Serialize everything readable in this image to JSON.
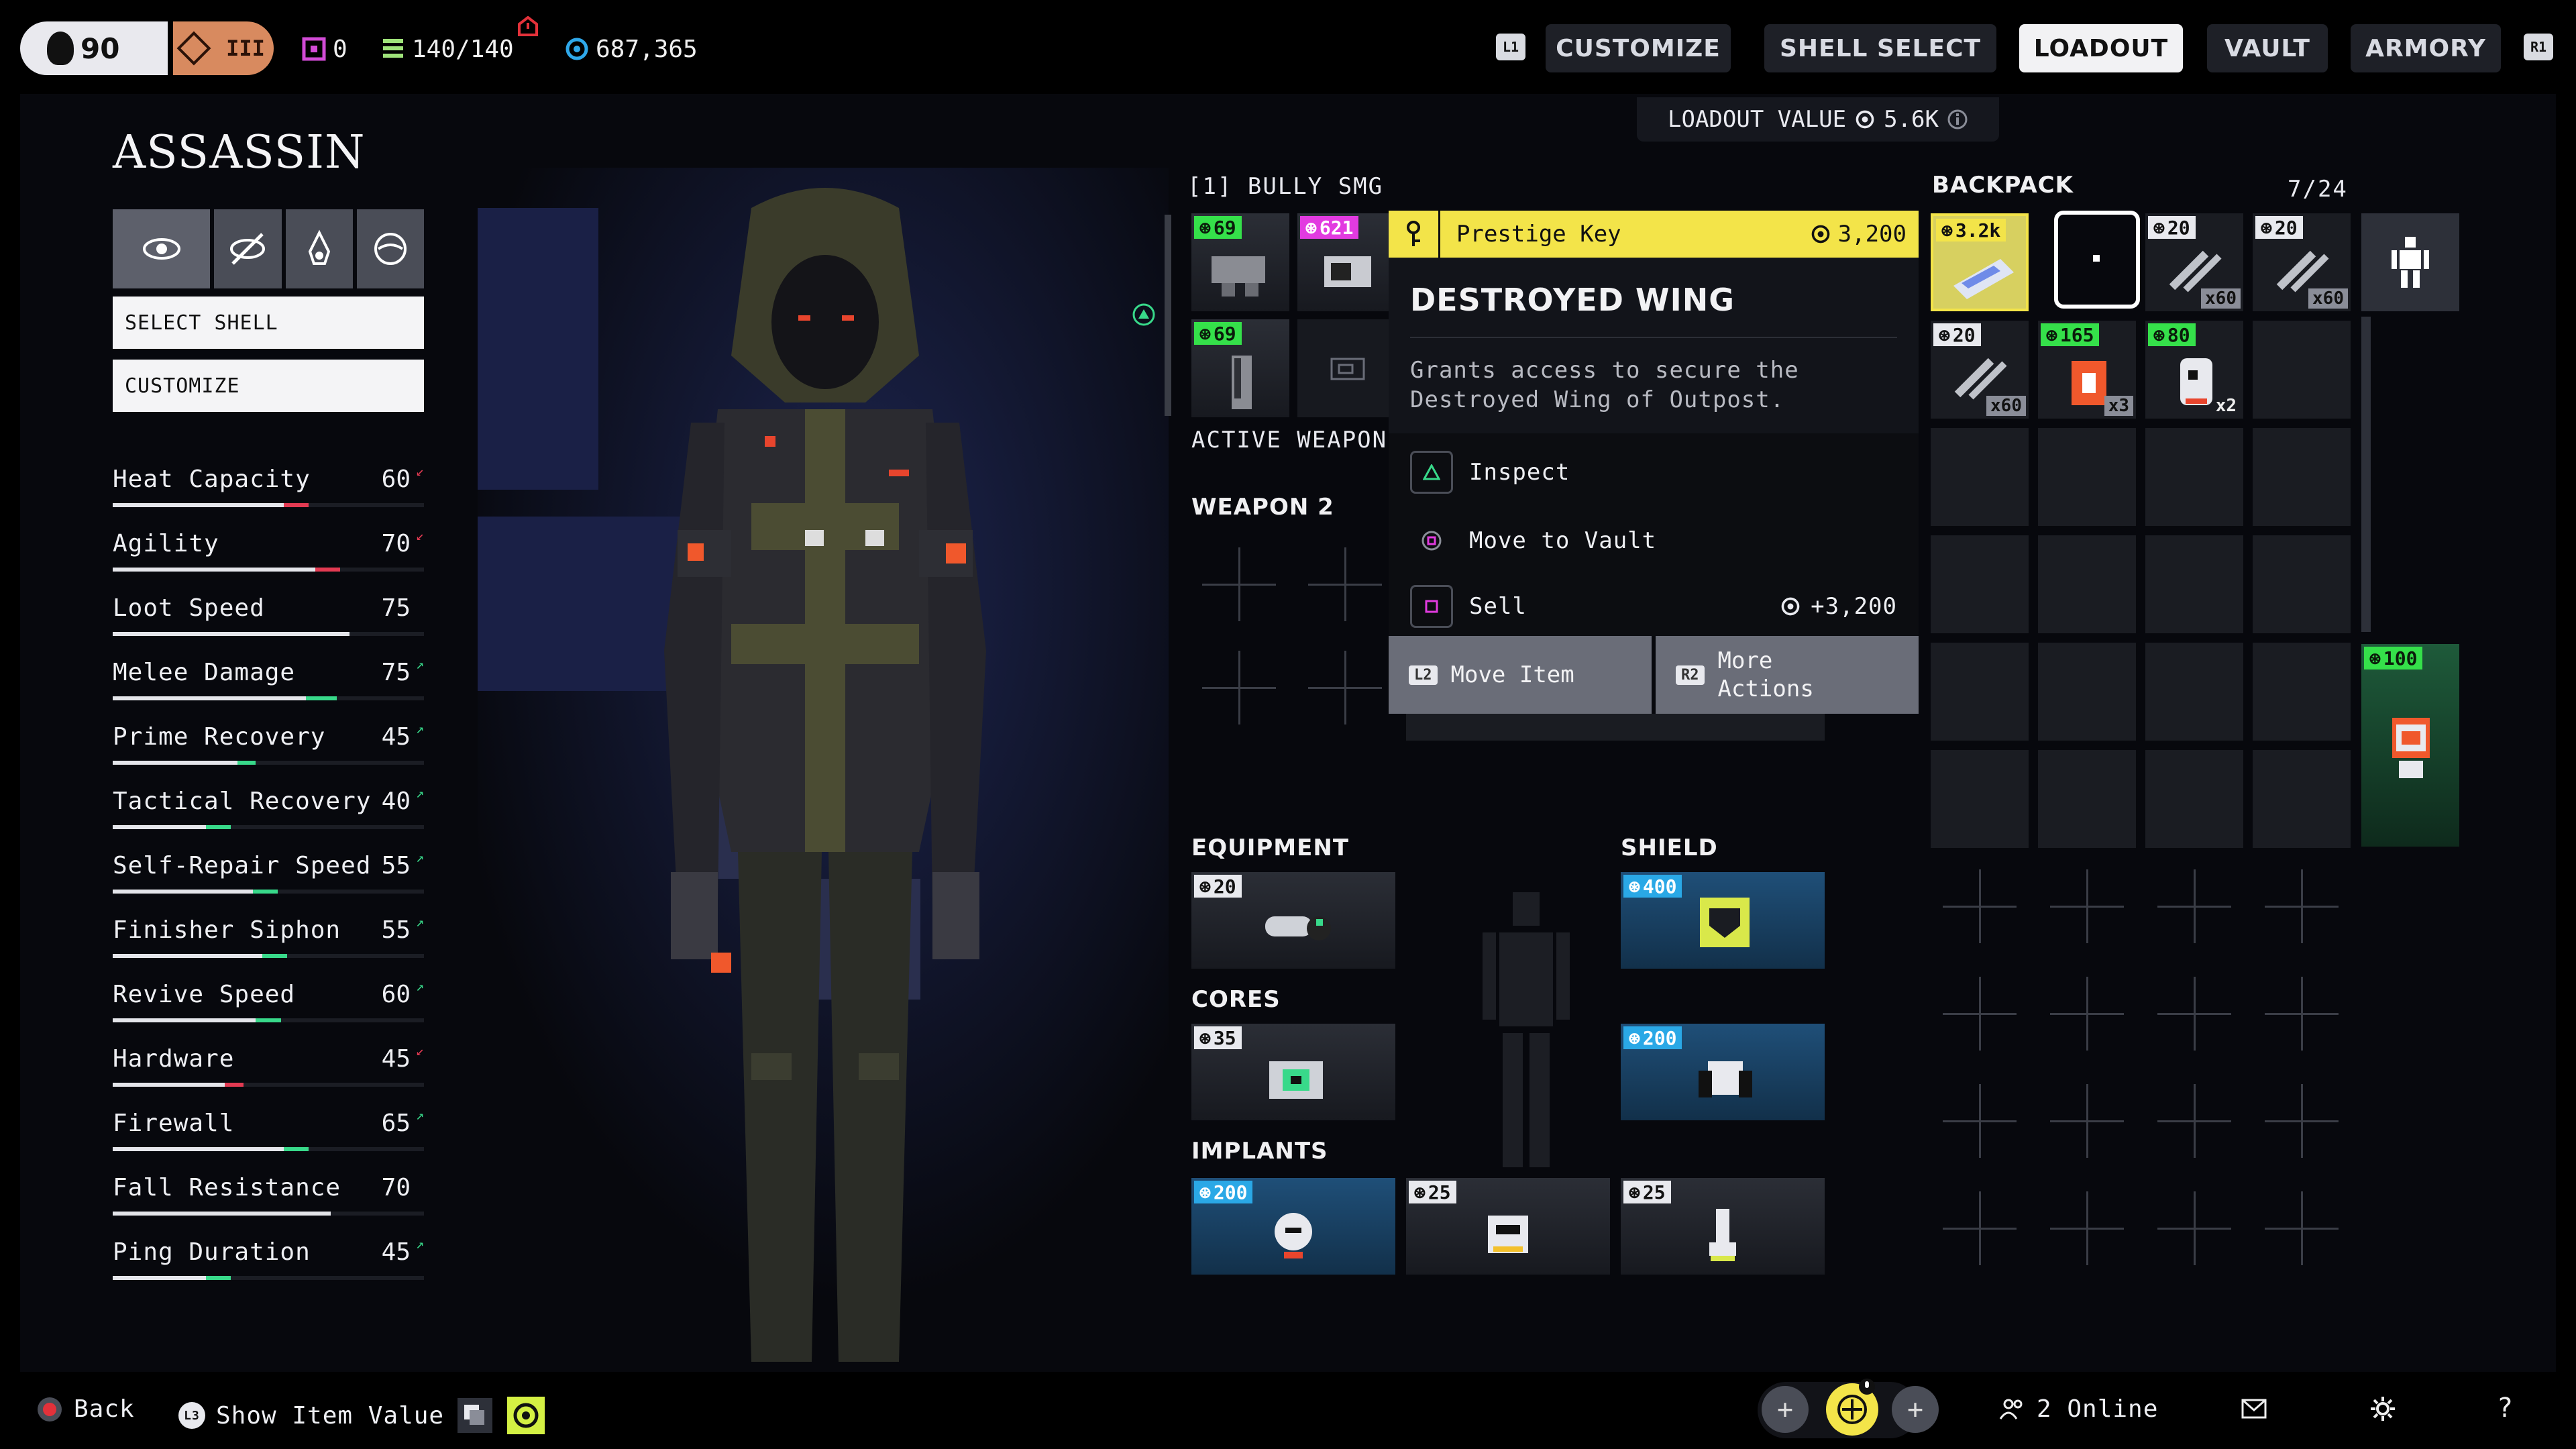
{
  "topbar": {
    "level": "90",
    "rank": "III",
    "currency_a": "0",
    "currency_b": "140/140",
    "credits": "687,365",
    "bumper_left": "L1",
    "bumper_right": "R1",
    "tabs": [
      {
        "label": "CUSTOMIZE"
      },
      {
        "label": "SHELL SELECT"
      },
      {
        "label": "LOADOUT"
      },
      {
        "label": "VAULT"
      },
      {
        "label": "ARMORY"
      }
    ]
  },
  "loadout_value": {
    "label": "LOADOUT VALUE",
    "value": "5.6K"
  },
  "shell": {
    "title": "ASSASSIN",
    "select_label": "SELECT SHELL",
    "customize_label": "CUSTOMIZE"
  },
  "stats": [
    {
      "name": "Heat Capacity",
      "value": "60",
      "trend": "down",
      "level": 0.55,
      "mod": 0.08,
      "mod_color": "#e33a52"
    },
    {
      "name": "Agility",
      "value": "70",
      "trend": "down",
      "level": 0.65,
      "mod": 0.08,
      "mod_color": "#e33a52"
    },
    {
      "name": "Loot Speed",
      "value": "75",
      "trend": "",
      "level": 0.76,
      "mod": 0,
      "mod_color": ""
    },
    {
      "name": "Melee Damage",
      "value": "75",
      "trend": "up",
      "level": 0.62,
      "mod": 0.1,
      "mod_color": "#38d98a"
    },
    {
      "name": "Prime Recovery",
      "value": "45",
      "trend": "up",
      "level": 0.4,
      "mod": 0.06,
      "mod_color": "#38d98a"
    },
    {
      "name": "Tactical Recovery",
      "value": "40",
      "trend": "up",
      "level": 0.3,
      "mod": 0.08,
      "mod_color": "#38d98a"
    },
    {
      "name": "Self-Repair Speed",
      "value": "55",
      "trend": "up",
      "level": 0.45,
      "mod": 0.08,
      "mod_color": "#38d98a"
    },
    {
      "name": "Finisher Siphon",
      "value": "55",
      "trend": "up",
      "level": 0.48,
      "mod": 0.08,
      "mod_color": "#38d98a"
    },
    {
      "name": "Revive Speed",
      "value": "60",
      "trend": "up",
      "level": 0.46,
      "mod": 0.08,
      "mod_color": "#38d98a"
    },
    {
      "name": "Hardware",
      "value": "45",
      "trend": "down",
      "level": 0.36,
      "mod": 0.06,
      "mod_color": "#e33a52"
    },
    {
      "name": "Firewall",
      "value": "65",
      "trend": "up",
      "level": 0.55,
      "mod": 0.08,
      "mod_color": "#38d98a"
    },
    {
      "name": "Fall Resistance",
      "value": "70",
      "trend": "",
      "level": 0.7,
      "mod": 0,
      "mod_color": ""
    },
    {
      "name": "Ping Duration",
      "value": "45",
      "trend": "up",
      "level": 0.3,
      "mod": 0.08,
      "mod_color": "#38d98a"
    }
  ],
  "weapons": {
    "weapon1_label": "[1] BULLY SMG",
    "active_label": "ACTIVE WEAPON",
    "weapon2_label": "WEAPON 2",
    "weapon1_slots": [
      {
        "value": "69",
        "color": "green"
      },
      {
        "value": "621",
        "color": "pink"
      },
      {
        "value": "69",
        "color": "green"
      }
    ]
  },
  "tooltip": {
    "category": "Prestige Key",
    "price": "3,200",
    "name": "DESTROYED WING",
    "description_line1": "Grants access to secure the",
    "description_line2": "Destroyed Wing of Outpost.",
    "action_inspect": "Inspect",
    "action_vault": "Move to Vault",
    "action_sell": "Sell",
    "sell_value": "+3,200",
    "footer_move_key": "L2",
    "footer_move": "Move Item",
    "footer_more_key": "R2",
    "footer_more_line1": "More",
    "footer_more_line2": "Actions"
  },
  "equipment": {
    "equipment_label": "EQUIPMENT",
    "shield_label": "SHIELD",
    "cores_label": "CORES",
    "implants_label": "IMPLANTS",
    "equipment_value": "20",
    "shield_value": "400",
    "cores_value": "35",
    "cores2_value": "200",
    "implants": [
      {
        "value": "200"
      },
      {
        "value": "25"
      },
      {
        "value": "25"
      }
    ]
  },
  "backpack": {
    "label": "BACKPACK",
    "count": "7/24",
    "items": [
      {
        "value": "3.2k",
        "color": "white",
        "qty": ""
      },
      {
        "value": "20",
        "color": "white",
        "qty": "x60"
      },
      {
        "value": "20",
        "color": "white",
        "qty": "x60"
      },
      {
        "value": "20",
        "color": "white",
        "qty": "x60"
      },
      {
        "value": "165",
        "color": "green",
        "qty": "x3"
      },
      {
        "value": "80",
        "color": "green",
        "qty": "x2"
      }
    ],
    "side_value": "100"
  },
  "bottombar": {
    "back_label": "Back",
    "show_value_key": "L3",
    "show_value_label": "Show Item Value",
    "online": "2 Online"
  }
}
